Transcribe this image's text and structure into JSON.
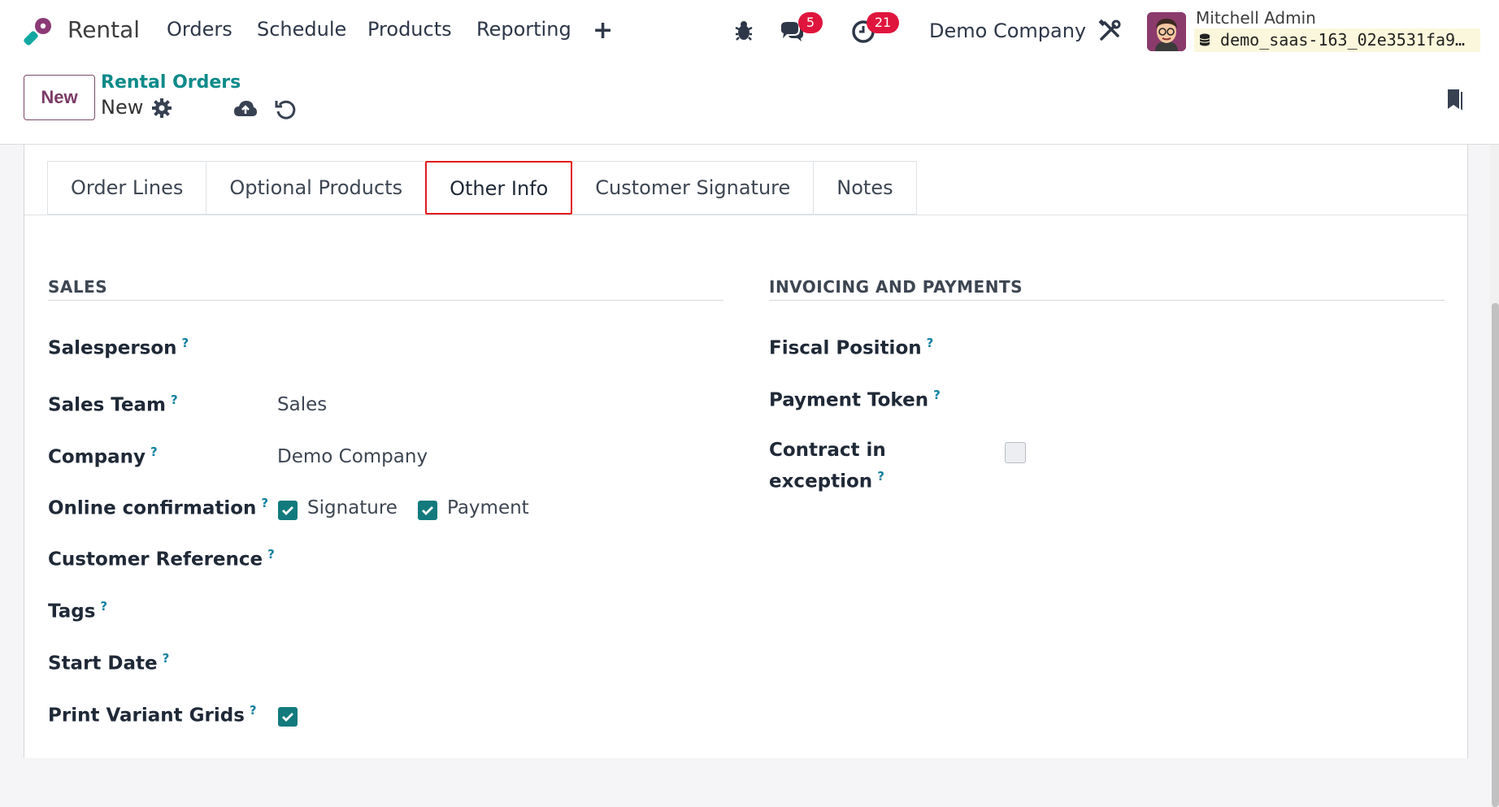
{
  "navbar": {
    "app_name": "Rental",
    "menu": [
      "Orders",
      "Schedule",
      "Products",
      "Reporting"
    ],
    "plus_label": "+",
    "chat_badge": "5",
    "activity_badge": "21",
    "company": "Demo Company",
    "user_name": "Mitchell Admin",
    "db_name": "demo_saas-163_02e3531fa9…",
    "colors": {
      "badge": "#e0153d",
      "logo_teal": "#12a7a2",
      "logo_purple": "#8b3a75"
    }
  },
  "control": {
    "new_label": "New",
    "breadcrumb_parent": "Rental Orders",
    "record_name": "New"
  },
  "tabs": [
    {
      "label": "Order Lines",
      "active": false
    },
    {
      "label": "Optional Products",
      "active": false
    },
    {
      "label": "Other Info",
      "active": true
    },
    {
      "label": "Customer Signature",
      "active": false
    },
    {
      "label": "Notes",
      "active": false
    }
  ],
  "sales": {
    "title": "SALES",
    "salesperson_label": "Salesperson",
    "sales_team_label": "Sales Team",
    "sales_team_value": "Sales",
    "company_label": "Company",
    "company_value": "Demo Company",
    "online_confirmation_label": "Online confirmation",
    "signature_label": "Signature",
    "signature_checked": true,
    "payment_label": "Payment",
    "payment_checked": true,
    "customer_reference_label": "Customer Reference",
    "tags_label": "Tags",
    "start_date_label": "Start Date",
    "print_variant_grids_label": "Print Variant Grids",
    "print_variant_grids_checked": true
  },
  "invoicing": {
    "title": "INVOICING AND PAYMENTS",
    "fiscal_position_label": "Fiscal Position",
    "payment_token_label": "Payment Token",
    "contract_exception_label_1": "Contract in",
    "contract_exception_label_2": "exception",
    "contract_exception_checked": false
  },
  "help_mark": "?"
}
